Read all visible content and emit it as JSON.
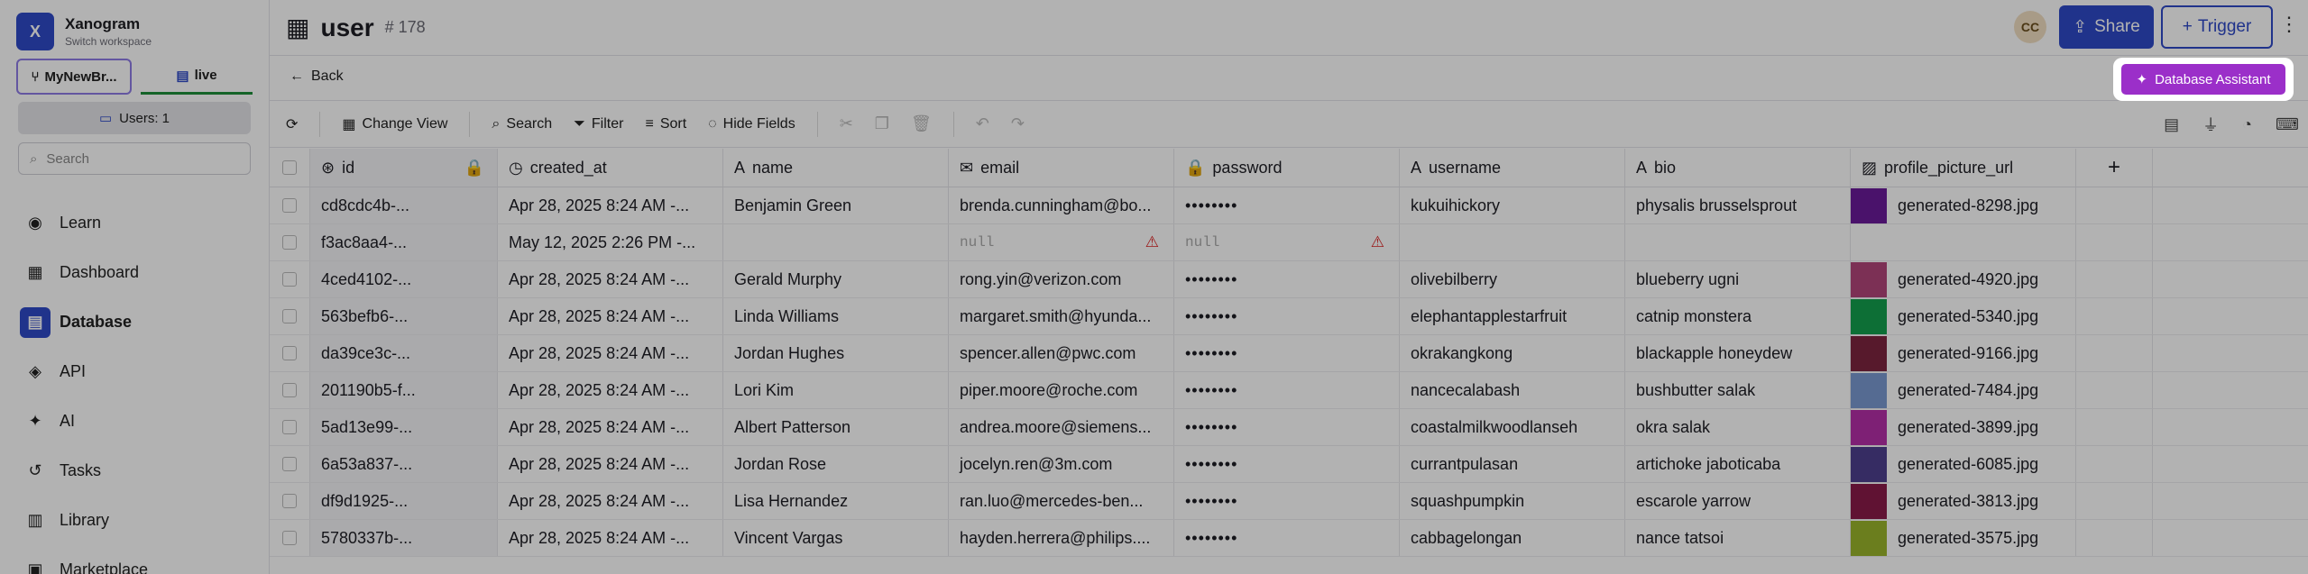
{
  "workspace": {
    "logo": "X",
    "name": "Xanogram",
    "subtitle": "Switch workspace"
  },
  "branches": {
    "b1": "MyNewBr...",
    "b2": "live"
  },
  "users_badge": "Users: 1",
  "search": {
    "placeholder": "Search"
  },
  "nav": [
    {
      "label": "Learn",
      "icon": "compass-icon"
    },
    {
      "label": "Dashboard",
      "icon": "dashboard-icon"
    },
    {
      "label": "Database",
      "icon": "database-icon"
    },
    {
      "label": "API",
      "icon": "layers-icon"
    },
    {
      "label": "AI",
      "icon": "sparkle-icon"
    },
    {
      "label": "Tasks",
      "icon": "history-icon"
    },
    {
      "label": "Library",
      "icon": "library-icon"
    },
    {
      "label": "Marketplace",
      "icon": "store-icon"
    }
  ],
  "header": {
    "title": "user",
    "rowcount": "# 178",
    "avatar": "CC",
    "share": "Share",
    "trigger": "Trigger"
  },
  "subbar": {
    "back": "Back",
    "assistant": "Database Assistant"
  },
  "toolbar": {
    "change_view": "Change View",
    "search": "Search",
    "filter": "Filter",
    "sort": "Sort",
    "hide_fields": "Hide Fields"
  },
  "columns": [
    "id",
    "created_at",
    "name",
    "email",
    "password",
    "username",
    "bio",
    "profile_picture_url"
  ],
  "rows": [
    {
      "id": "cd8cdc4b-...",
      "created_at": "Apr 28, 2025 8:24 AM -...",
      "name": "Benjamin Green",
      "email": "brenda.cunningham@bo...",
      "password": "••••••••",
      "username": "kukuihickory",
      "bio": "physalis brusselsprout",
      "color": "#6a1b9a",
      "pic": "generated-8298.jpg"
    },
    {
      "id": "f3ac8aa4-...",
      "created_at": "May 12, 2025 2:26 PM -...",
      "name": "",
      "email": "null",
      "password": "null",
      "username": "",
      "bio": "",
      "color": "",
      "pic": ""
    },
    {
      "id": "4ced4102-...",
      "created_at": "Apr 28, 2025 8:24 AM -...",
      "name": "Gerald Murphy",
      "email": "rong.yin@verizon.com",
      "password": "••••••••",
      "username": "olivebilberry",
      "bio": "blueberry ugni",
      "color": "#b2457a",
      "pic": "generated-4920.jpg"
    },
    {
      "id": "563befb6-...",
      "created_at": "Apr 28, 2025 8:24 AM -...",
      "name": "Linda Williams",
      "email": "margaret.smith@hyunda...",
      "password": "••••••••",
      "username": "elephantapplestarfruit",
      "bio": "catnip monstera",
      "color": "#14a04e",
      "pic": "generated-5340.jpg"
    },
    {
      "id": "da39ce3c-...",
      "created_at": "Apr 28, 2025 8:24 AM -...",
      "name": "Jordan Hughes",
      "email": "spencer.allen@pwc.com",
      "password": "••••••••",
      "username": "okrakangkong",
      "bio": "blackapple honeydew",
      "color": "#7d2540",
      "pic": "generated-9166.jpg"
    },
    {
      "id": "201190b5-f...",
      "created_at": "Apr 28, 2025 8:24 AM -...",
      "name": "Lori Kim",
      "email": "piper.moore@roche.com",
      "password": "••••••••",
      "username": "nancecalabash",
      "bio": "bushbutter salak",
      "color": "#7a9ad2",
      "pic": "generated-7484.jpg"
    },
    {
      "id": "5ad13e99-...",
      "created_at": "Apr 28, 2025 8:24 AM -...",
      "name": "Albert Patterson",
      "email": "andrea.moore@siemens...",
      "password": "••••••••",
      "username": "coastalmilkwoodlanseh",
      "bio": "okra salak",
      "color": "#b52fa8",
      "pic": "generated-3899.jpg"
    },
    {
      "id": "6a53a837-...",
      "created_at": "Apr 28, 2025 8:24 AM -...",
      "name": "Jordan Rose",
      "email": "jocelyn.ren@3m.com",
      "password": "••••••••",
      "username": "currantpulasan",
      "bio": "artichoke jaboticaba",
      "color": "#4e3f8f",
      "pic": "generated-6085.jpg"
    },
    {
      "id": "df9d1925-...",
      "created_at": "Apr 28, 2025 8:24 AM -...",
      "name": "Lisa Hernandez",
      "email": "ran.luo@mercedes-ben...",
      "password": "••••••••",
      "username": "squashpumpkin",
      "bio": "escarole yarrow",
      "color": "#8a1a4a",
      "pic": "generated-3813.jpg"
    },
    {
      "id": "5780337b-...",
      "created_at": "Apr 28, 2025 8:24 AM -...",
      "name": "Vincent Vargas",
      "email": "hayden.herrera@philips....",
      "password": "••••••••",
      "username": "cabbagelongan",
      "bio": "nance tatsoi",
      "color": "#9ab52c",
      "pic": "generated-3575.jpg"
    }
  ]
}
